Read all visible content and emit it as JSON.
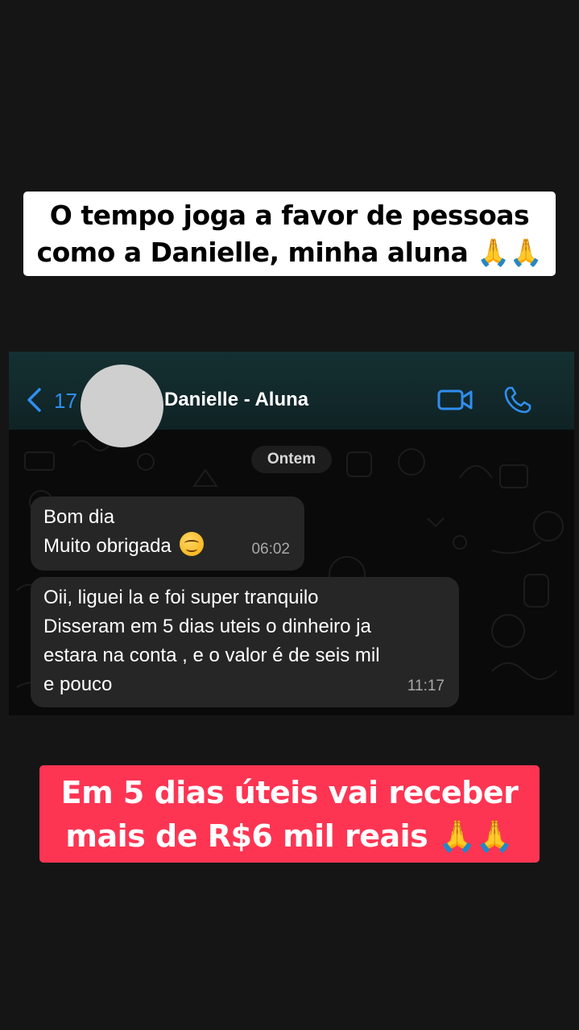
{
  "captions": {
    "top": {
      "line1": "O tempo joga a favor de pessoas",
      "line2": "como a Danielle, minha aluna 🙏🙏"
    },
    "bottom": {
      "line1": "Em 5 dias úteis vai receber",
      "line2": "mais de R$6 mil reais 🙏🙏"
    }
  },
  "chat": {
    "header": {
      "back_icon": "chevron-left-icon",
      "back_count": "17",
      "contact_name": "Danielle - Aluna",
      "video_icon": "video-camera-icon",
      "call_icon": "phone-icon",
      "accent_color": "#2f8ef0"
    },
    "date_separator": "Ontem",
    "messages": [
      {
        "lines": [
          "Bom dia",
          "Muito obrigada"
        ],
        "emoji": "☺️",
        "time": "06:02"
      },
      {
        "lines": [
          "Oii, liguei la e foi super tranquilo",
          "Disseram em 5 dias uteis o dinheiro ja",
          "estara na conta , e o valor é de seis mil",
          "e pouco"
        ],
        "time": "11:17"
      }
    ]
  },
  "colors": {
    "background": "#151515",
    "bottom_caption_bg": "#fd3553",
    "bubble_bg": "#262626"
  }
}
